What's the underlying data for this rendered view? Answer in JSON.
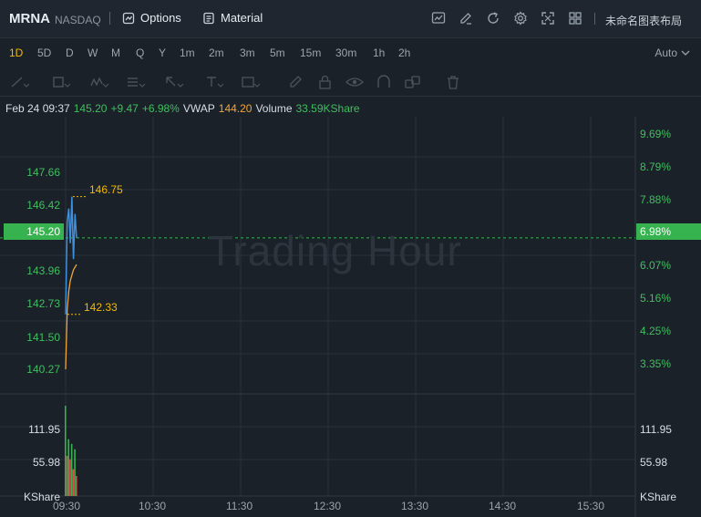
{
  "header": {
    "symbol": "MRNA",
    "exchange": "NASDAQ",
    "options_label": "Options",
    "material_label": "Material",
    "layout_label": "未命名图表布局",
    "icons": [
      "chart-icon",
      "edit-icon",
      "refresh-icon",
      "settings-icon",
      "fullscreen-icon",
      "grid-icon"
    ]
  },
  "timeframes": [
    "1D",
    "5D",
    "D",
    "W",
    "M",
    "Q",
    "Y",
    "1m",
    "2m",
    "3m",
    "5m",
    "15m",
    "30m",
    "1h",
    "2h"
  ],
  "active_timeframe": "1D",
  "scale_mode": "Auto",
  "info": {
    "datetime": "Feb 24 09:37",
    "price": "145.20",
    "change": "+9.47",
    "change_pct": "+6.98%",
    "vwap_label": "VWAP",
    "vwap": "144.20",
    "volume_label": "Volume",
    "volume": "33.59KShare"
  },
  "watermark": "Trading Hour",
  "y_left_labels": [
    "147.66",
    "146.42",
    "143.96",
    "142.73",
    "141.50",
    "140.27"
  ],
  "y_right_labels": [
    "9.69%",
    "8.79%",
    "7.88%",
    "6.07%",
    "5.16%",
    "4.25%",
    "3.35%"
  ],
  "current_price": "145.20",
  "current_pct": "6.98%",
  "high_annotation": "146.75",
  "low_annotation": "142.33",
  "volume_labels": [
    "111.95",
    "55.98",
    "KShare"
  ],
  "x_labels": [
    "09:30",
    "10:30",
    "11:30",
    "12:30",
    "13:30",
    "14:30",
    "15:30"
  ],
  "colors": {
    "up": "#36b34f",
    "down": "#e5484d",
    "price_line": "#3d8fe0",
    "vwap_line": "#f0a53a",
    "annotation": "#f5b800"
  },
  "chart_data": {
    "type": "line",
    "x": [
      "09:30",
      "09:31",
      "09:32",
      "09:33",
      "09:34",
      "09:35",
      "09:36",
      "09:37"
    ],
    "series": [
      {
        "values": [
          142.33,
          145.8,
          146.3,
          145.0,
          146.75,
          144.4,
          146.1,
          145.2
        ]
      },
      {
        "name": "VWAP",
        "values": [
          140.27,
          142.5,
          143.2,
          143.6,
          143.8,
          144.0,
          144.1,
          144.2
        ]
      }
    ],
    "volume": [
      135,
      60,
      85,
      55,
      78,
      40,
      70,
      30
    ],
    "ylim": [
      139.5,
      148.5
    ],
    "volume_max": 150
  }
}
